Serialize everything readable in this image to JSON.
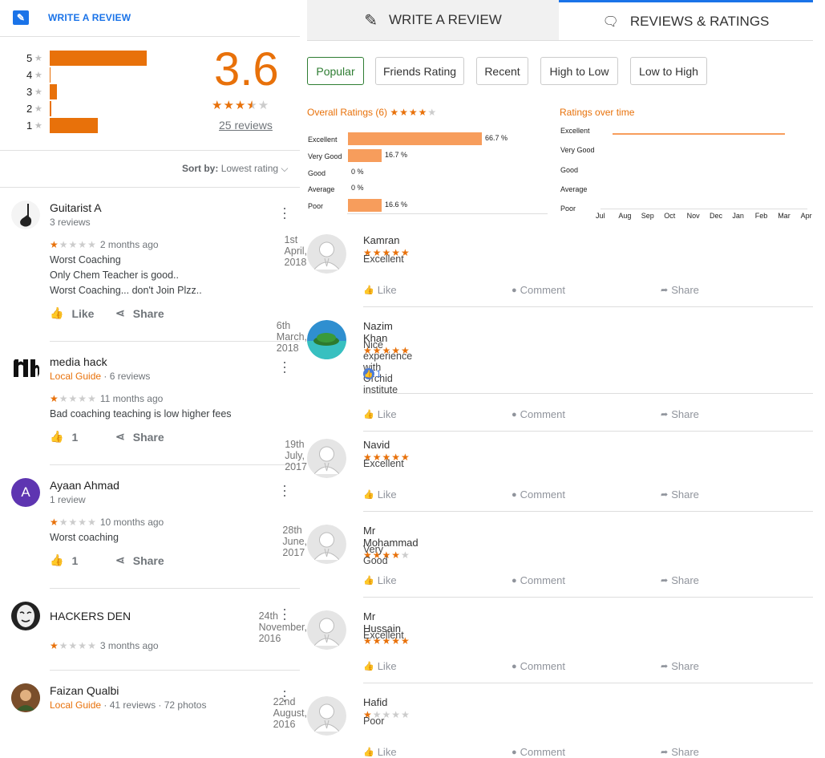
{
  "left": {
    "write_review": "WRITE A REVIEW",
    "histogram": [
      {
        "star": "5",
        "share": 0.667
      },
      {
        "star": "4",
        "share": 0.0
      },
      {
        "star": "3",
        "share": 0.05
      },
      {
        "star": "2",
        "share": 0.01
      },
      {
        "star": "1",
        "share": 0.33
      }
    ],
    "score": "3.6",
    "score_stars": 3.5,
    "reviews_link": "25 reviews",
    "sort_label": "Sort by:",
    "sort_value": "Lowest rating",
    "reviews": [
      {
        "name": "Guitarist A",
        "meta": "3 reviews",
        "local_guide": "",
        "rating": 1,
        "time": "2 months ago",
        "lines": [
          "Worst Coaching",
          "Only Chem Teacher is good..",
          "Worst Coaching... don't Join Plzz.."
        ],
        "like_label": "Like",
        "share_label": "Share"
      },
      {
        "name": "media hack",
        "meta": "· 6 reviews",
        "local_guide": "Local Guide",
        "rating": 1,
        "time": "11 months ago",
        "lines": [
          "Bad coaching teaching is low higher fees"
        ],
        "like_label": "1",
        "share_label": "Share"
      },
      {
        "name": "Ayaan Ahmad",
        "meta": "1 review",
        "local_guide": "",
        "rating": 1,
        "time": "10 months ago",
        "lines": [
          "Worst coaching"
        ],
        "like_label": "1",
        "share_label": "Share",
        "avatar_letter": "A"
      },
      {
        "name": "HACKERS DEN",
        "meta": "",
        "local_guide": "",
        "rating": 1,
        "time": "3 months ago",
        "lines": []
      },
      {
        "name": "Faizan Qualbi",
        "meta": "· 41 reviews · 72 photos",
        "local_guide": "Local Guide"
      }
    ]
  },
  "right": {
    "tab_write": "WRITE A REVIEW",
    "tab_reviews": "REVIEWS & RATINGS",
    "filters": [
      "Popular",
      "Friends Rating",
      "Recent",
      "High to Low",
      "Low to High"
    ],
    "overall_title": "Overall Ratings (6)",
    "overall_stars": 4,
    "overall": [
      {
        "label": "Excellent",
        "pct": "66.7 %",
        "value": 66.7
      },
      {
        "label": "Very Good",
        "pct": "16.7 %",
        "value": 16.7
      },
      {
        "label": "Good",
        "pct": "0 %",
        "value": 0
      },
      {
        "label": "Average",
        "pct": "0 %",
        "value": 0
      },
      {
        "label": "Poor",
        "pct": "16.6 %",
        "value": 16.6
      }
    ],
    "time_title": "Ratings over time",
    "time_levels": [
      "Excellent",
      "Very Good",
      "Good",
      "Average",
      "Poor"
    ],
    "time_months": [
      "Jul",
      "Aug",
      "Sep",
      "Oct",
      "Nov",
      "Dec",
      "Jan",
      "Feb",
      "Mar",
      "Apr"
    ],
    "posts": [
      {
        "name": "Kamran",
        "rating": 5,
        "date": "1st April, 2018",
        "text": "Excellent",
        "likes": ""
      },
      {
        "name": "Nazim Khan",
        "rating": 5,
        "date": "6th March, 2018",
        "text": "Nice experience with Orchid institute",
        "likes": "1"
      },
      {
        "name": "Navid",
        "rating": 5,
        "date": "19th July, 2017",
        "text": "Excellent",
        "likes": ""
      },
      {
        "name": "Mr Mohammad",
        "rating": 4,
        "date": "28th June, 2017",
        "text": "Very Good",
        "likes": ""
      },
      {
        "name": "Mr Hussain",
        "rating": 5,
        "date": "24th November, 2016",
        "text": "Excellent",
        "likes": ""
      },
      {
        "name": "Hafid",
        "rating": 1,
        "date": "22nd August, 2016",
        "text": "Poor",
        "likes": ""
      }
    ],
    "action_like": "Like",
    "action_comment": "Comment",
    "action_share": "Share"
  },
  "colors": {
    "accent": "#e8710a",
    "link": "#1a73e8",
    "active_filter": "#2e7d32",
    "bar": "#f79d5c"
  }
}
